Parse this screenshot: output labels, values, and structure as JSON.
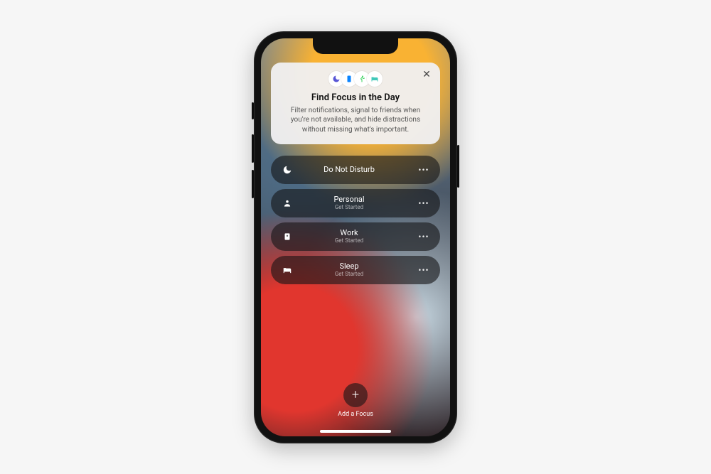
{
  "card": {
    "title": "Find Focus in the Day",
    "description": "Filter notifications, signal to friends when you're not available, and hide distractions without missing what's important.",
    "close_glyph": "✕",
    "icons": [
      {
        "name": "moon-icon",
        "color": "#5856d6"
      },
      {
        "name": "phone-icon",
        "color": "#0a84ff"
      },
      {
        "name": "runner-icon",
        "color": "#30d158"
      },
      {
        "name": "bed-icon",
        "color": "#40c8b8"
      }
    ]
  },
  "focus_items": [
    {
      "icon": "moon-icon",
      "label": "Do Not Disturb",
      "sub": ""
    },
    {
      "icon": "person-icon",
      "label": "Personal",
      "sub": "Get Started"
    },
    {
      "icon": "badge-icon",
      "label": "Work",
      "sub": "Get Started"
    },
    {
      "icon": "bed-icon",
      "label": "Sleep",
      "sub": "Get Started"
    }
  ],
  "more_glyph": "•••",
  "add": {
    "glyph": "+",
    "label": "Add a Focus"
  }
}
